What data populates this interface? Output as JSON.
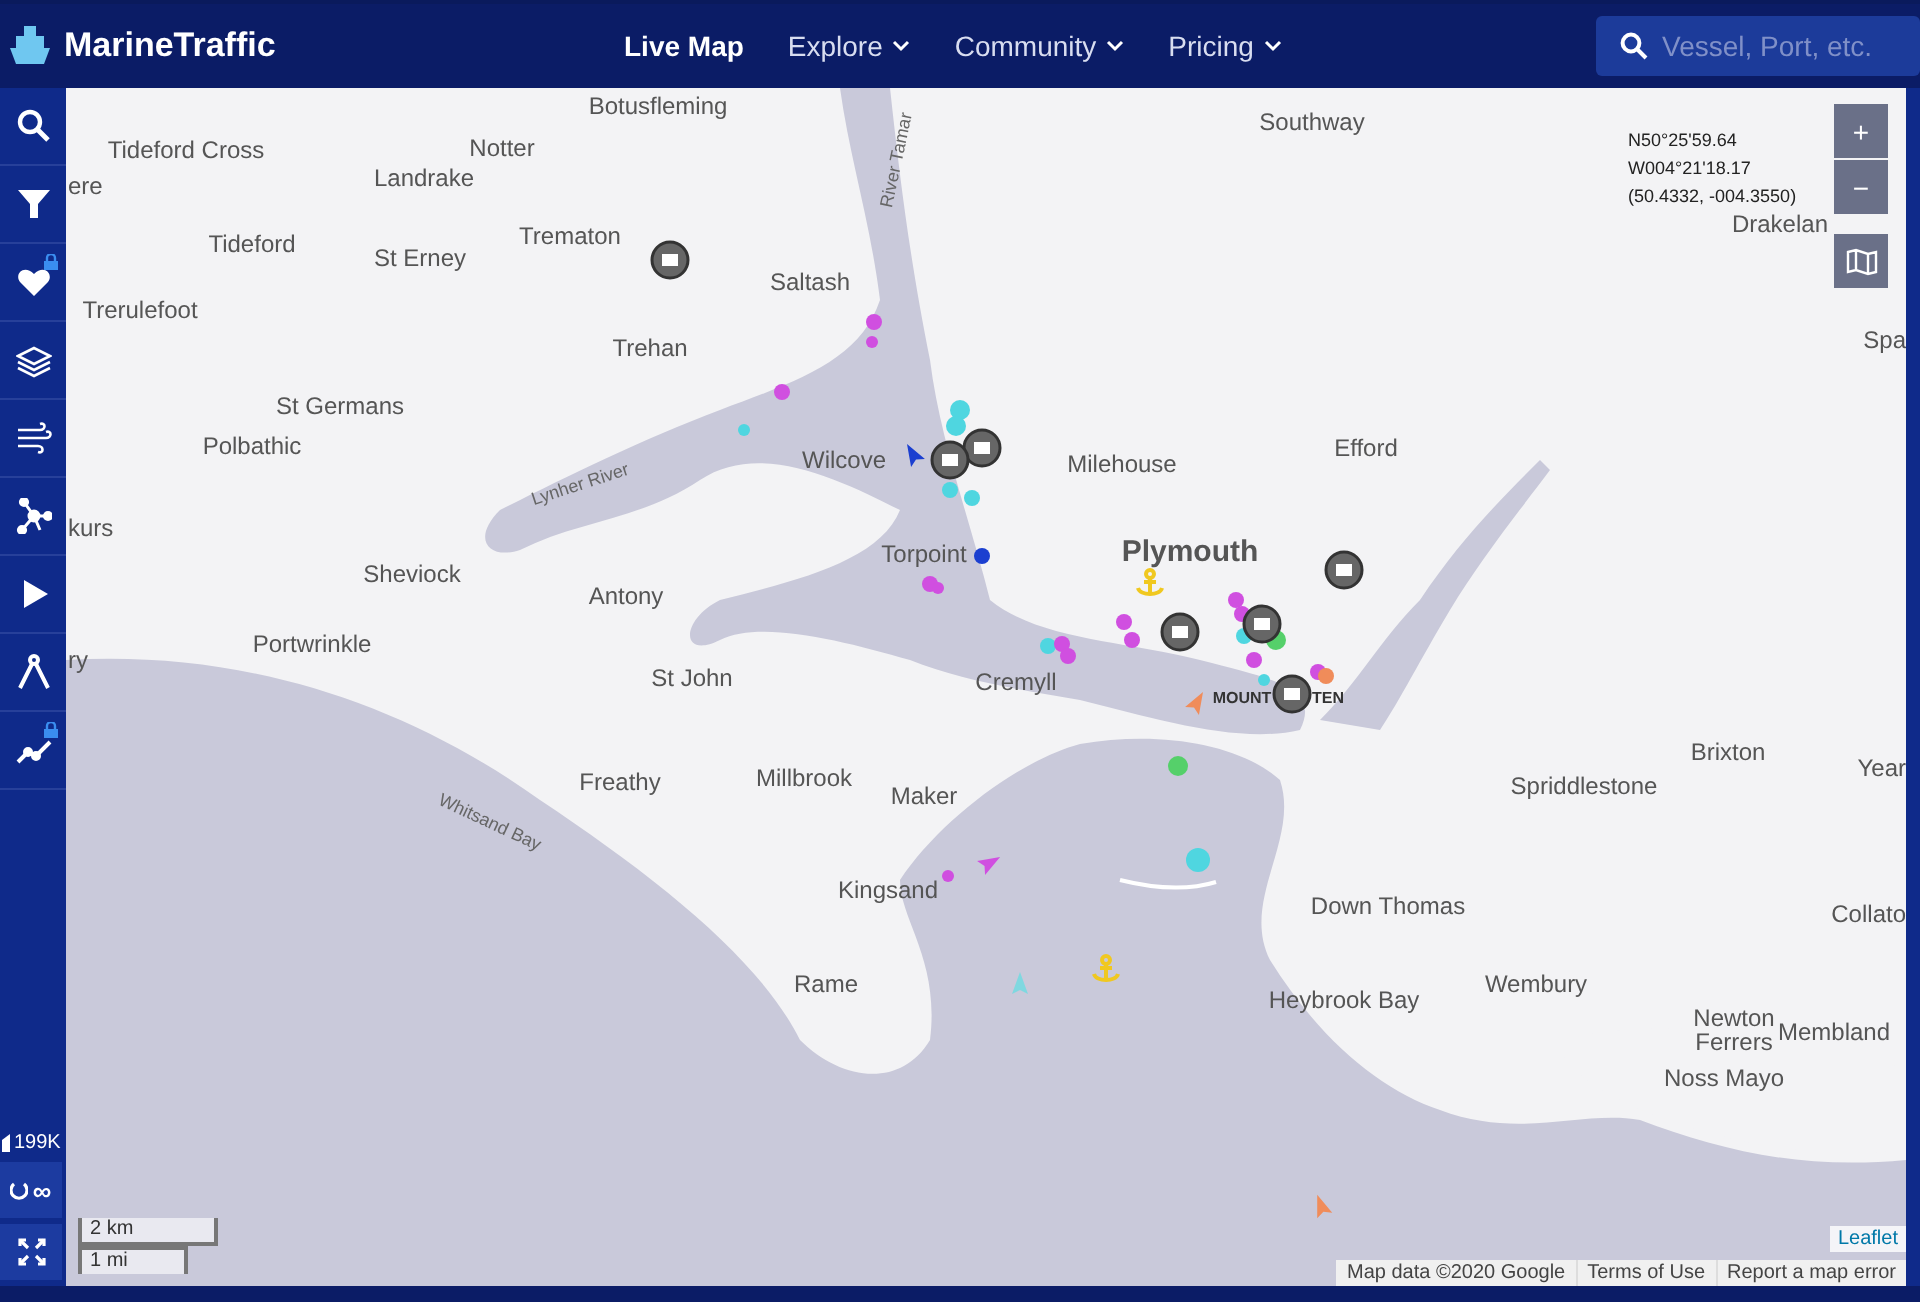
{
  "header": {
    "logo": "MarineTraffic",
    "nav": [
      {
        "label": "Live Map",
        "selected": true,
        "dropdown": false
      },
      {
        "label": "Explore",
        "selected": false,
        "dropdown": true
      },
      {
        "label": "Community",
        "selected": false,
        "dropdown": true
      },
      {
        "label": "Pricing",
        "selected": false,
        "dropdown": true
      }
    ],
    "search": {
      "placeholder": "Vessel, Port, etc."
    }
  },
  "sidebar": {
    "items": [
      {
        "kind": "search",
        "locked": false
      },
      {
        "kind": "filter",
        "locked": false
      },
      {
        "kind": "favourites",
        "locked": true
      },
      {
        "kind": "layers",
        "locked": false
      },
      {
        "kind": "weather",
        "locked": false
      },
      {
        "kind": "network",
        "locked": false
      },
      {
        "kind": "play",
        "locked": false
      },
      {
        "kind": "measure",
        "locked": false
      },
      {
        "kind": "chart",
        "locked": true
      }
    ],
    "vessel_count": "199K",
    "refresh_label": "∞"
  },
  "map": {
    "coordinates": [
      "N50°25'59.64",
      "W004°21'18.17",
      "(50.4332, -004.3550)"
    ],
    "zoom_in": "+",
    "zoom_out": "−",
    "places": [
      {
        "name": "Botusfleming",
        "kind": "town"
      },
      {
        "name": "Southway",
        "kind": "town"
      },
      {
        "name": "Tideford Cross",
        "kind": "town"
      },
      {
        "name": "Notter",
        "kind": "town"
      },
      {
        "name": "Landrake",
        "kind": "town"
      },
      {
        "name": "ere",
        "kind": "town"
      },
      {
        "name": "Tideford",
        "kind": "town"
      },
      {
        "name": "St Erney",
        "kind": "town"
      },
      {
        "name": "Trematon",
        "kind": "town"
      },
      {
        "name": "Saltash",
        "kind": "town"
      },
      {
        "name": "Drakelan",
        "kind": "town"
      },
      {
        "name": "Trerulefoot",
        "kind": "town"
      },
      {
        "name": "Trehan",
        "kind": "town"
      },
      {
        "name": "Spa",
        "kind": "town"
      },
      {
        "name": "St Germans",
        "kind": "town"
      },
      {
        "name": "Polbathic",
        "kind": "town"
      },
      {
        "name": "Wilcove",
        "kind": "town"
      },
      {
        "name": "Efford",
        "kind": "town"
      },
      {
        "name": "Milehouse",
        "kind": "town"
      },
      {
        "name": "kurs",
        "kind": "town"
      },
      {
        "name": "Torpoint",
        "kind": "town"
      },
      {
        "name": "Plymouth",
        "kind": "city"
      },
      {
        "name": "Sheviock",
        "kind": "town"
      },
      {
        "name": "Antony",
        "kind": "town"
      },
      {
        "name": "Portwrinkle",
        "kind": "town"
      },
      {
        "name": "ry",
        "kind": "town"
      },
      {
        "name": "St John",
        "kind": "town"
      },
      {
        "name": "Cremyll",
        "kind": "town"
      },
      {
        "name": "MOUNT",
        "kind": "district"
      },
      {
        "name": "TEN",
        "kind": "district"
      },
      {
        "name": "Brixton",
        "kind": "town"
      },
      {
        "name": "Year",
        "kind": "town"
      },
      {
        "name": "Freathy",
        "kind": "town"
      },
      {
        "name": "Millbrook",
        "kind": "town"
      },
      {
        "name": "Maker",
        "kind": "town"
      },
      {
        "name": "Spriddlestone",
        "kind": "town"
      },
      {
        "name": "Kingsand",
        "kind": "town"
      },
      {
        "name": "Down Thomas",
        "kind": "town"
      },
      {
        "name": "Collato",
        "kind": "town"
      },
      {
        "name": "Rame",
        "kind": "town"
      },
      {
        "name": "Heybrook Bay",
        "kind": "town"
      },
      {
        "name": "Wembury",
        "kind": "town"
      },
      {
        "name": "Newton Ferrers",
        "kind": "town"
      },
      {
        "name": "Membland",
        "kind": "town"
      },
      {
        "name": "Noss Mayo",
        "kind": "town"
      }
    ],
    "water_labels": [
      "River Tamar",
      "Lynher River",
      "Whitsand Bay"
    ],
    "scale": [
      "2 km",
      "1 mi"
    ],
    "attribution": {
      "leaflet": "Leaflet",
      "links": [
        "Map data ©2020 Google",
        "Terms of Use",
        "Report a map error"
      ]
    }
  }
}
